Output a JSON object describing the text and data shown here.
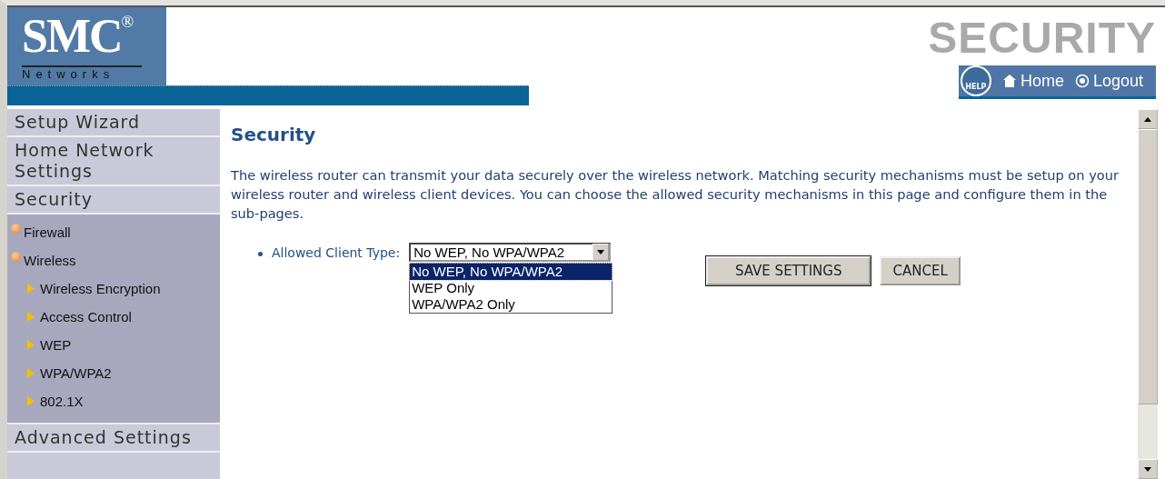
{
  "header": {
    "logo": "SMC",
    "logo_mark": "®",
    "logo_sub": "Networks",
    "page_banner": "SECURITY",
    "nav": [
      {
        "kind": "help",
        "label": "HELP"
      },
      {
        "kind": "home",
        "label": "Home"
      },
      {
        "kind": "logout",
        "label": "Logout"
      }
    ]
  },
  "sidebar": {
    "items": [
      {
        "label": "Setup Wizard"
      },
      {
        "label": "Home Network Settings"
      },
      {
        "label": "Security",
        "children": [
          {
            "label": "Firewall"
          },
          {
            "label": "Wireless",
            "children": [
              {
                "label": "Wireless Encryption"
              },
              {
                "label": "Access Control"
              },
              {
                "label": "WEP"
              },
              {
                "label": "WPA/WPA2"
              },
              {
                "label": "802.1X"
              }
            ]
          }
        ]
      },
      {
        "label": "Advanced Settings"
      }
    ]
  },
  "content": {
    "title": "Security",
    "description": "The wireless router can transmit your data securely over the wireless network. Matching security mechanisms must be setup on your wireless router and wireless client devices. You can choose the allowed security mechanisms in this page and configure them in the sub-pages.",
    "field": {
      "label": "Allowed Client Type:",
      "value": "No WEP, No WPA/WPA2",
      "expanded": true,
      "options": [
        {
          "label": "No WEP, No WPA/WPA2",
          "selected": true
        },
        {
          "label": "WEP Only",
          "selected": false
        },
        {
          "label": "WPA/WPA2 Only",
          "selected": false
        }
      ]
    },
    "buttons": [
      {
        "label": "SAVE SETTINGS",
        "default": true
      },
      {
        "label": "CANCEL",
        "default": false
      }
    ]
  }
}
